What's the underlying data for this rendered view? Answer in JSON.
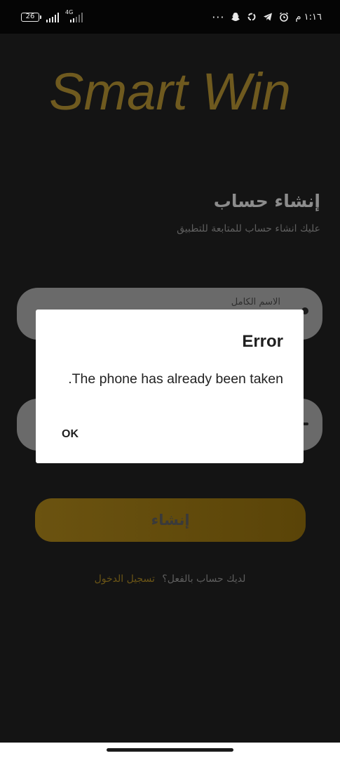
{
  "status_bar": {
    "battery_level": "26",
    "network_type": "4G",
    "time": "١:١٦ م",
    "more_indicator": "···",
    "icons": [
      "snapchat-icon",
      "sync-icon",
      "telegram-icon",
      "alarm-icon"
    ]
  },
  "app": {
    "logo_text": "Smart Win",
    "logo_color": "#6f5a1f"
  },
  "form": {
    "title": "إنشاء حساب",
    "subtitle": "عليك انشاء حساب للمتابعة للتطبيق",
    "full_name_placeholder": "الاسم الكامل",
    "submit_label": "إنشاء",
    "have_account_text": "لديك حساب بالفعل؟",
    "login_link": "تسجيل الدخول"
  },
  "dialog": {
    "title": "Error",
    "message": ".The phone has already been taken",
    "ok_label": "OK"
  },
  "colors": {
    "accent": "#6b5310",
    "background": "#141414"
  }
}
